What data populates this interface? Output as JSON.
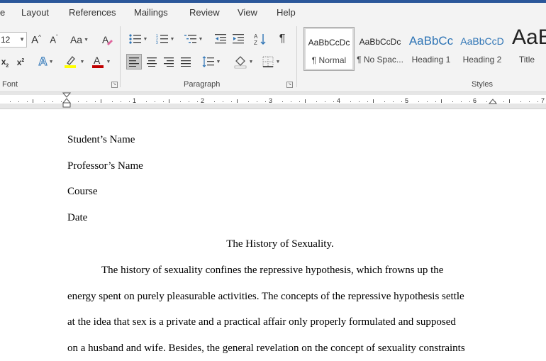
{
  "menu": [
    "Layout",
    "References",
    "Mailings",
    "Review",
    "View",
    "Help"
  ],
  "ribbon": {
    "font_size": "12",
    "groups": {
      "font": "Font",
      "paragraph": "Paragraph",
      "styles": "Styles"
    },
    "styles": [
      {
        "sample": "AaBbCcDc",
        "name": "¶ Normal"
      },
      {
        "sample": "AaBbCcDc",
        "name": "¶ No Spac..."
      },
      {
        "sample": "AaBbCc",
        "name": "Heading 1"
      },
      {
        "sample": "AaBbCcD",
        "name": "Heading 2"
      },
      {
        "sample": "AaB",
        "name": "Title"
      }
    ]
  },
  "ruler": {
    "numbers": [
      "1",
      "2",
      "3",
      "4",
      "5",
      "6",
      "7"
    ]
  },
  "document": {
    "header_lines": [
      "Student’s Name",
      "Professor’s Name",
      "Course",
      "Date"
    ],
    "title": "The History of Sexuality.",
    "body_lines": [
      "The history of sexuality confines the repressive hypothesis, which frowns up the",
      "energy spent on purely pleasurable activities. The concepts of the repressive hypothesis settle",
      "at the idea that sex is a private and a practical affair only properly formulated and supposed",
      "on a husband and wife. Besides, the general revelation on the concept of sexuality constraints"
    ]
  },
  "colors": {
    "accent": "#2b579a",
    "highlight": "#ffff00",
    "font_color": "#c00000",
    "styles_blue": "#2e74b5"
  }
}
